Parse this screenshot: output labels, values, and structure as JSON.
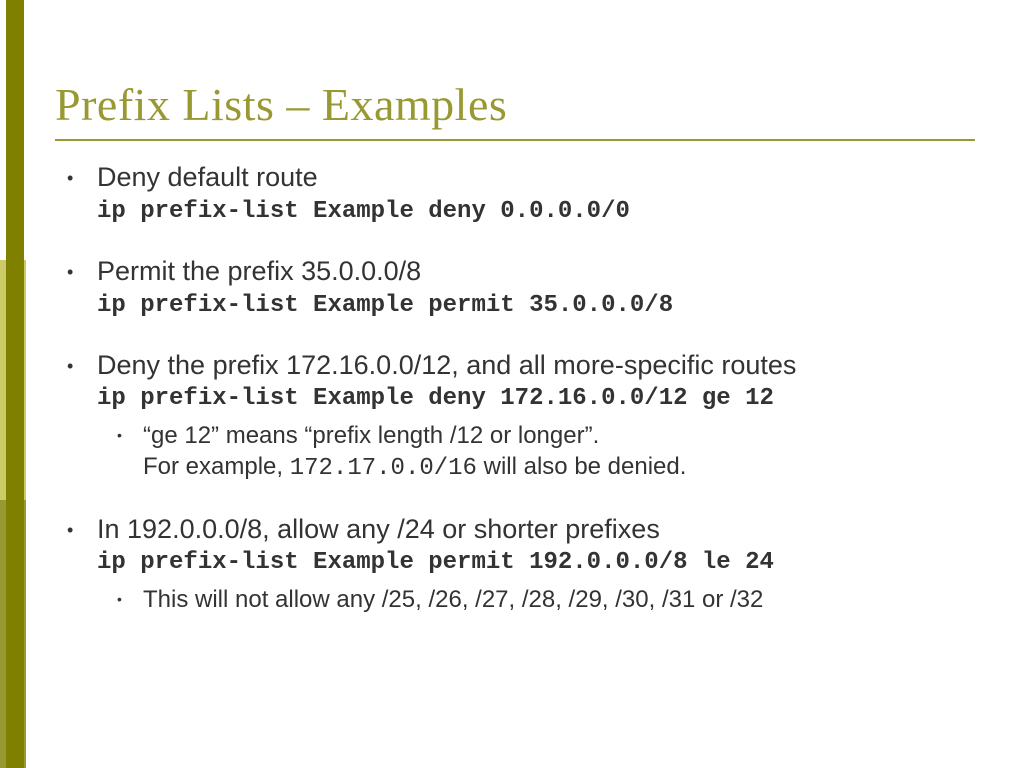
{
  "title": "Prefix Lists – Examples",
  "b1": {
    "desc": "Deny default route",
    "cmd": "ip prefix-list Example deny 0.0.0.0/0"
  },
  "b2": {
    "desc": "Permit the prefix 35.0.0.0/8",
    "cmd": "ip prefix-list Example permit 35.0.0.0/8"
  },
  "b3": {
    "desc": "Deny the prefix 172.16.0.0/12, and all more-specific routes",
    "cmd": "ip prefix-list Example deny 172.16.0.0/12 ge 12",
    "s1a": "“ge 12” means “prefix length /12 or longer”.",
    "s1b_pre": "For example, ",
    "s1b_code": "172.17.0.0/16",
    "s1b_post": " will also be denied."
  },
  "b4": {
    "desc": "In 192.0.0.0/8, allow any /24 or shorter prefixes",
    "cmd": "ip prefix-list Example permit 192.0.0.0/8 le 24",
    "s1": "This will not allow any /25, /26, /27, /28, /29, /30, /31 or /32"
  }
}
